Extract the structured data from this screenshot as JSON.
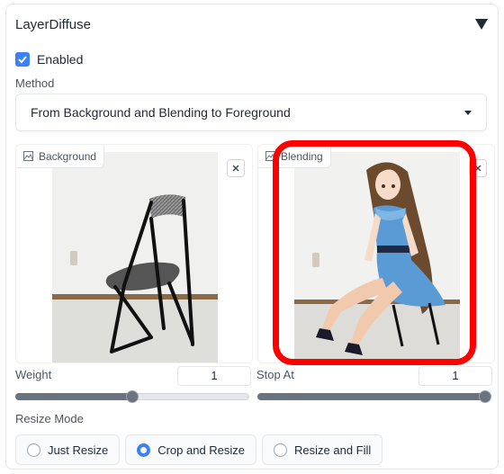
{
  "panel": {
    "title": "LayerDiffuse",
    "enabled_label": "Enabled",
    "enabled": true
  },
  "method": {
    "label": "Method",
    "value": "From Background and Blending to Foreground"
  },
  "images": {
    "background_label": "Background",
    "blending_label": "Blending"
  },
  "weight": {
    "label": "Weight",
    "value": "1",
    "fraction": 0.5
  },
  "stop_at": {
    "label": "Stop At",
    "value": "1",
    "fraction": 1.0
  },
  "resize": {
    "label": "Resize Mode",
    "options": [
      "Just Resize",
      "Crop and Resize",
      "Resize and Fill"
    ],
    "selected": "Crop and Resize"
  },
  "colors": {
    "accent": "#3b82f6",
    "highlight": "#ff0000"
  }
}
